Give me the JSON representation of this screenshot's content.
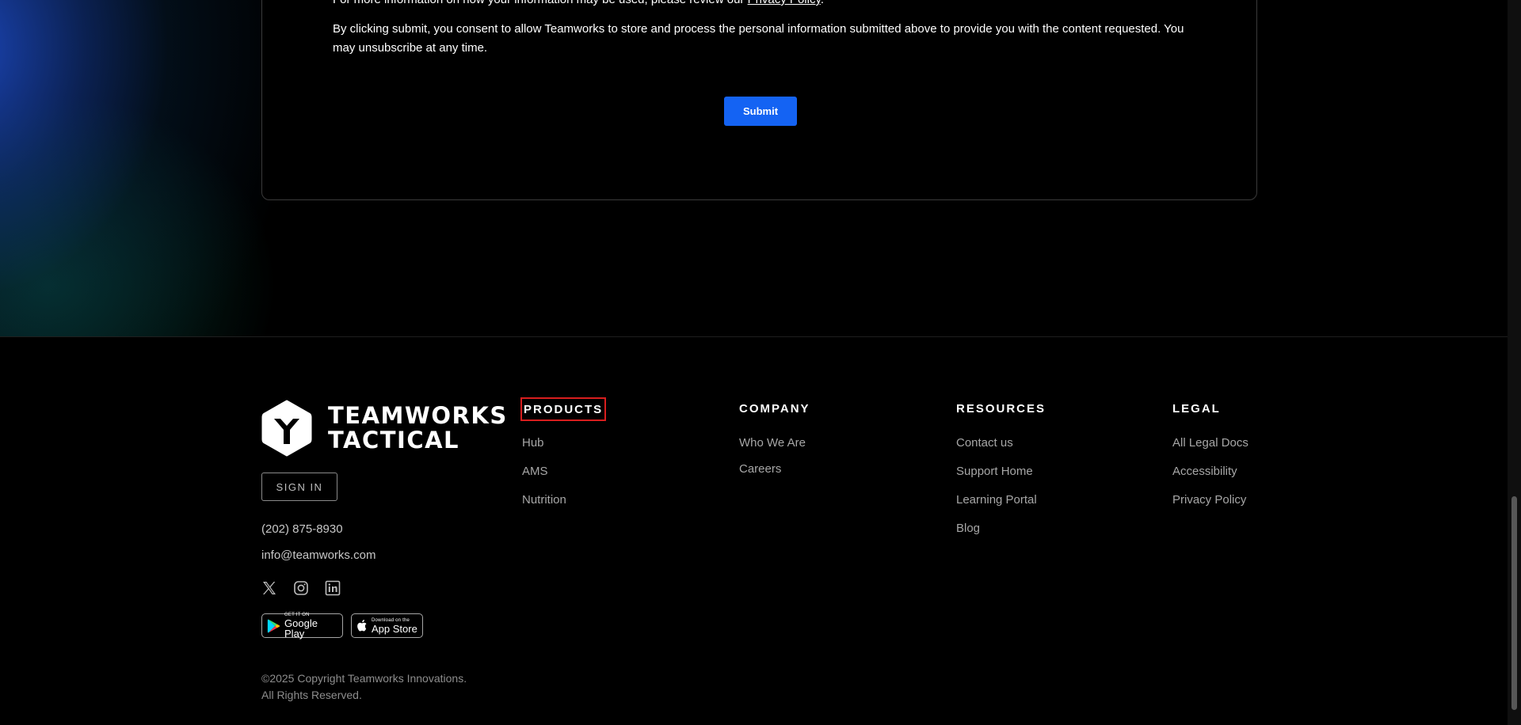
{
  "form": {
    "privacy_prefix": "For more information on how your information may be used, please review our",
    "privacy_link": "Privacy Policy",
    "privacy_suffix": ".",
    "consent_text": "By clicking submit, you consent to allow Teamworks to store and process the personal information submitted above to provide you with the content requested. You may unsubscribe at any time.",
    "submit_label": "Submit"
  },
  "footer": {
    "logo": {
      "line1": "TEAMWORKS",
      "line2": "TACTICAL"
    },
    "signin_label": "SIGN IN",
    "phone": "(202) 875-8930",
    "email": "info@teamworks.com",
    "social": [
      "x-icon",
      "instagram-icon",
      "linkedin-icon"
    ],
    "stores": {
      "google": {
        "small": "GET IT ON",
        "big": "Google Play"
      },
      "apple": {
        "small": "Download on the",
        "big": "App Store"
      }
    },
    "copyright_line1": "©2025 Copyright Teamworks Innovations.",
    "copyright_line2": "All Rights Reserved.",
    "columns": {
      "products": {
        "heading": "PRODUCTS",
        "items": [
          "Hub",
          "AMS",
          "Nutrition"
        ]
      },
      "company": {
        "heading": "COMPANY",
        "items": [
          "Who We Are",
          "Careers"
        ]
      },
      "resources": {
        "heading": "RESOURCES",
        "items": [
          "Contact us",
          "Support Home",
          "Learning Portal",
          "Blog"
        ]
      },
      "legal": {
        "heading": "LEGAL",
        "items": [
          "All Legal Docs",
          "Accessibility",
          "Privacy Policy"
        ]
      }
    }
  },
  "colors": {
    "accent": "#1463f3",
    "highlight_border": "#d81e1e",
    "background": "#000000"
  }
}
